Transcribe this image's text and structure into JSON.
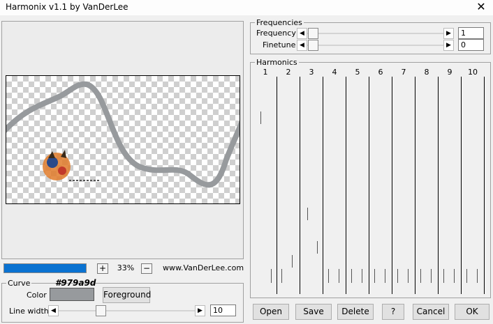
{
  "window": {
    "title": "Harmonix v1.1 by VanDerLee"
  },
  "icons": {
    "close": "close-icon"
  },
  "progress": {
    "value": 1.0,
    "color": "#0a72d1"
  },
  "zoom": {
    "plus": "+",
    "value": "33%",
    "minus": "−"
  },
  "website": "www.VanDerLee.com",
  "curve": {
    "legend": "Curve",
    "color_label": "Color",
    "color_hex": "#979a9d",
    "foreground_label": "Foreground",
    "line_width_label": "Line width",
    "line_width": "10"
  },
  "frequencies": {
    "legend": "Frequencies",
    "frequency_label": "Frequency",
    "frequency": "1",
    "finetune_label": "Finetune",
    "finetune": "0"
  },
  "harmonics": {
    "legend": "Harmonics",
    "labels": [
      "1",
      "2",
      "3",
      "4",
      "5",
      "6",
      "7",
      "8",
      "9",
      "10"
    ]
  },
  "buttons": {
    "open": "Open",
    "save": "Save",
    "delete": "Delete",
    "help": "?",
    "cancel": "Cancel",
    "ok": "OK"
  }
}
